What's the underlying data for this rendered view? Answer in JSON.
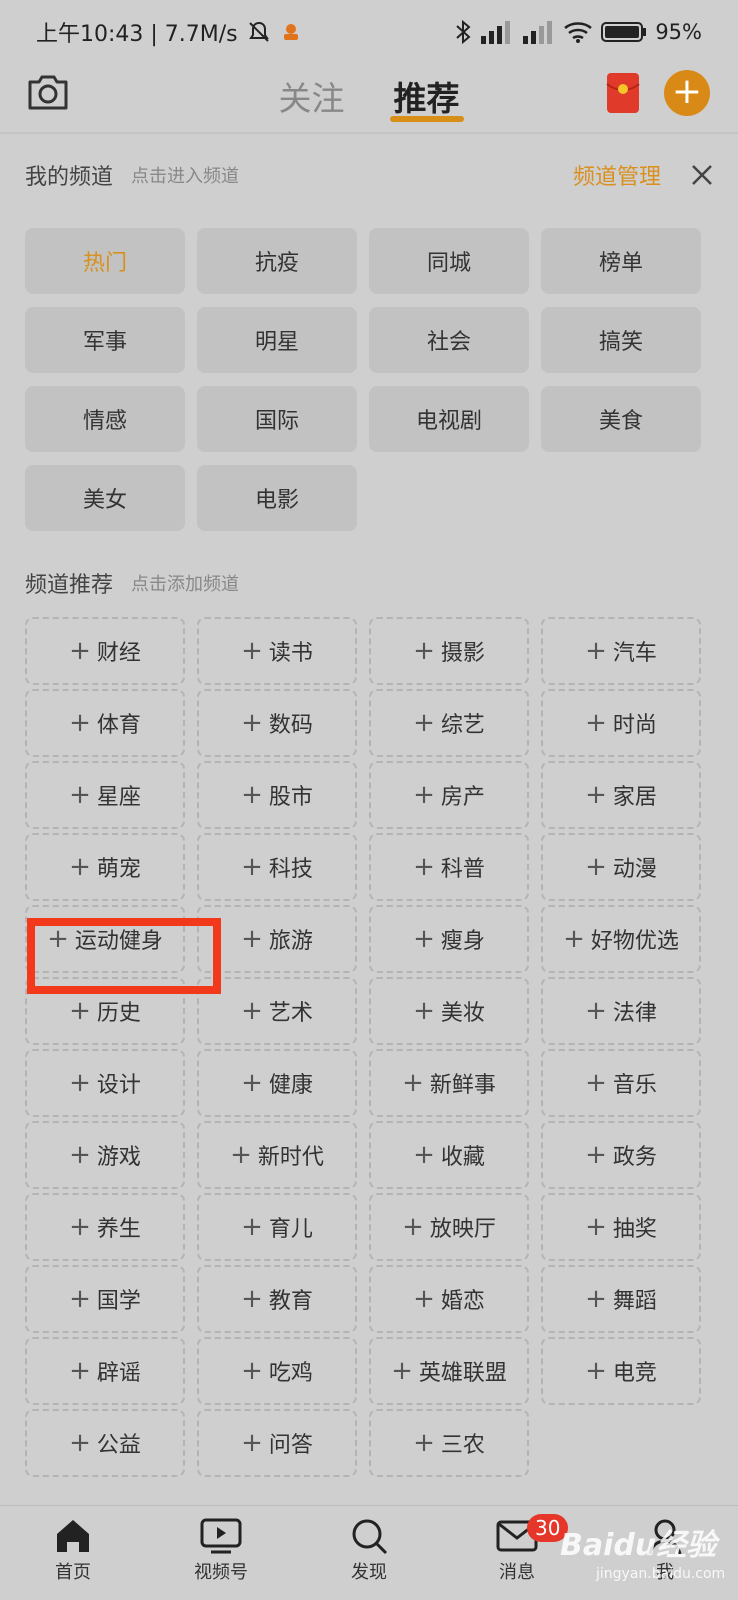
{
  "status": {
    "time": "上午10:43 | 7.7M/s",
    "battery": "95%"
  },
  "nav": {
    "tabs": [
      "关注",
      "推荐"
    ],
    "active_tab": "推荐"
  },
  "my_channels": {
    "title": "我的频道",
    "hint": "点击进入频道",
    "manage": "频道管理",
    "items": [
      "热门",
      "抗疫",
      "同城",
      "榜单",
      "军事",
      "明星",
      "社会",
      "搞笑",
      "情感",
      "国际",
      "电视剧",
      "美食",
      "美女",
      "电影"
    ]
  },
  "recommended": {
    "title": "频道推荐",
    "hint": "点击添加频道",
    "items": [
      "财经",
      "读书",
      "摄影",
      "汽车",
      "体育",
      "数码",
      "综艺",
      "时尚",
      "星座",
      "股市",
      "房产",
      "家居",
      "萌宠",
      "科技",
      "科普",
      "动漫",
      "运动健身",
      "旅游",
      "瘦身",
      "好物优选",
      "历史",
      "艺术",
      "美妆",
      "法律",
      "设计",
      "健康",
      "新鲜事",
      "音乐",
      "游戏",
      "新时代",
      "收藏",
      "政务",
      "养生",
      "育儿",
      "放映厅",
      "抽奖",
      "国学",
      "教育",
      "婚恋",
      "舞蹈",
      "辟谣",
      "吃鸡",
      "英雄联盟",
      "电竞",
      "公益",
      "问答",
      "三农"
    ]
  },
  "bottom_nav": {
    "home": "首页",
    "video": "视频号",
    "discover": "发现",
    "messages": "消息",
    "messages_badge": "30",
    "me": "我"
  },
  "watermark": {
    "brand": "Baidu经验",
    "url": "jingyan.baidu.com"
  },
  "colors": {
    "accent": "#d98a16",
    "highlight": "#f3391c",
    "badge": "#e53629"
  }
}
